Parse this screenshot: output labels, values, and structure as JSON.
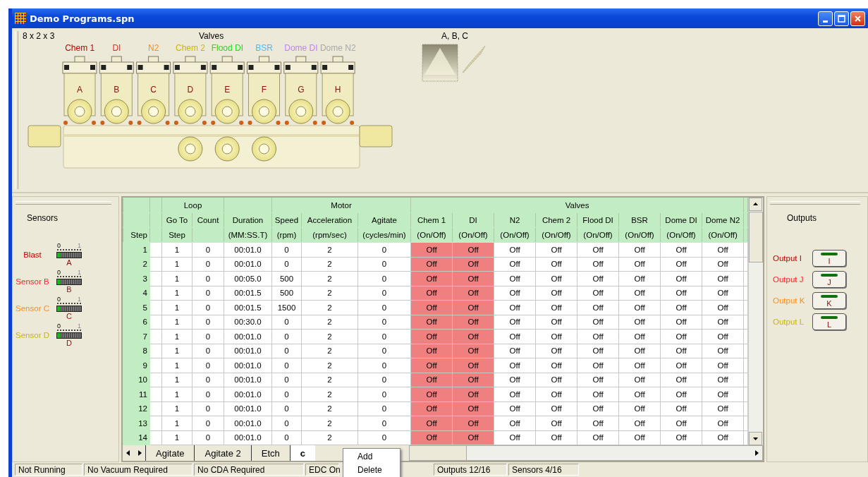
{
  "window": {
    "title": "Demo Programs.spn"
  },
  "manifold": {
    "config": "8 x 2 x 3",
    "title": "Valves",
    "valves": [
      {
        "label": "Chem 1",
        "color": "#c00000",
        "letter": "A"
      },
      {
        "label": "DI",
        "color": "#ff2020",
        "letter": "B"
      },
      {
        "label": "N2",
        "color": "#ff8c1a",
        "letter": "C"
      },
      {
        "label": "Chem 2",
        "color": "#c8b800",
        "letter": "D"
      },
      {
        "label": "Flood DI",
        "color": "#20e020",
        "letter": "E"
      },
      {
        "label": "BSR",
        "color": "#50b8ff",
        "letter": "F"
      },
      {
        "label": "Dome DI",
        "color": "#c080ff",
        "letter": "G"
      },
      {
        "label": "Dome N2",
        "color": "#a8a8a8",
        "letter": "H"
      }
    ],
    "nozzle_title": "A, B, C"
  },
  "sensors": {
    "title": "Sensors",
    "items": [
      {
        "name": "Blast",
        "color": "#c00000",
        "letter": "A",
        "scale_min": "0",
        "scale_max": "1",
        "level": 0.12
      },
      {
        "name": "Sensor B",
        "color": "#ff2020",
        "letter": "B",
        "scale_min": "0",
        "scale_max": "1",
        "level": 0.12
      },
      {
        "name": "Sensor C",
        "color": "#ff8c1a",
        "letter": "C",
        "scale_min": "0",
        "scale_max": "1",
        "level": 0.12
      },
      {
        "name": "Sensor D",
        "color": "#c8b800",
        "letter": "D",
        "scale_min": "0",
        "scale_max": "1",
        "level": 0.12
      }
    ]
  },
  "table": {
    "step_header": "Step",
    "loop": {
      "title": "Loop",
      "goto": [
        "Go To",
        "Step"
      ],
      "count": "Count"
    },
    "duration": [
      "Duration",
      "(MM:SS.T)"
    ],
    "motor": {
      "title": "Motor",
      "columns": [
        [
          "Speed",
          "(rpm)"
        ],
        [
          "Acceleration",
          "(rpm/sec)"
        ],
        [
          "Agitate",
          "(cycles/min)"
        ]
      ]
    },
    "valves_title": "Valves",
    "valve_columns": [
      {
        "name": "Chem 1",
        "unit": "(On/Off)",
        "highlighted": true
      },
      {
        "name": "DI",
        "unit": "(On/Off)",
        "highlighted": true
      },
      {
        "name": "N2",
        "unit": "(On/Off)",
        "highlighted": false
      },
      {
        "name": "Chem 2",
        "unit": "(On/Off)",
        "highlighted": false
      },
      {
        "name": "Flood DI",
        "unit": "(On/Off)",
        "highlighted": false
      },
      {
        "name": "BSR",
        "unit": "(On/Off)",
        "highlighted": false
      },
      {
        "name": "Dome DI",
        "unit": "(On/Off)",
        "highlighted": false
      },
      {
        "name": "Dome N2",
        "unit": "(On/Off)",
        "highlighted": false
      }
    ],
    "rows": [
      {
        "step": "1",
        "goto": "1",
        "count": "0",
        "duration": "00:01.0",
        "motor": [
          "0",
          "2",
          "0"
        ],
        "valves": [
          "Off",
          "Off",
          "Off",
          "Off",
          "Off",
          "Off",
          "Off",
          "Off"
        ]
      },
      {
        "step": "2",
        "goto": "1",
        "count": "0",
        "duration": "00:01.0",
        "motor": [
          "0",
          "2",
          "0"
        ],
        "valves": [
          "Off",
          "Off",
          "Off",
          "Off",
          "Off",
          "Off",
          "Off",
          "Off"
        ]
      },
      {
        "step": "3",
        "goto": "1",
        "count": "0",
        "duration": "00:05.0",
        "motor": [
          "500",
          "2",
          "0"
        ],
        "valves": [
          "Off",
          "Off",
          "Off",
          "Off",
          "Off",
          "Off",
          "Off",
          "Off"
        ]
      },
      {
        "step": "4",
        "goto": "1",
        "count": "0",
        "duration": "00:01.5",
        "motor": [
          "500",
          "2",
          "0"
        ],
        "valves": [
          "Off",
          "Off",
          "Off",
          "Off",
          "Off",
          "Off",
          "Off",
          "Off"
        ]
      },
      {
        "step": "5",
        "goto": "1",
        "count": "0",
        "duration": "00:01.5",
        "motor": [
          "1500",
          "2",
          "0"
        ],
        "valves": [
          "Off",
          "Off",
          "Off",
          "Off",
          "Off",
          "Off",
          "Off",
          "Off"
        ]
      },
      {
        "step": "6",
        "goto": "1",
        "count": "0",
        "duration": "00:30.0",
        "motor": [
          "0",
          "2",
          "0"
        ],
        "valves": [
          "Off",
          "Off",
          "Off",
          "Off",
          "Off",
          "Off",
          "Off",
          "Off"
        ]
      },
      {
        "step": "7",
        "goto": "1",
        "count": "0",
        "duration": "00:01.0",
        "motor": [
          "0",
          "2",
          "0"
        ],
        "valves": [
          "Off",
          "Off",
          "Off",
          "Off",
          "Off",
          "Off",
          "Off",
          "Off"
        ]
      },
      {
        "step": "8",
        "goto": "1",
        "count": "0",
        "duration": "00:01.0",
        "motor": [
          "0",
          "2",
          "0"
        ],
        "valves": [
          "Off",
          "Off",
          "Off",
          "Off",
          "Off",
          "Off",
          "Off",
          "Off"
        ]
      },
      {
        "step": "9",
        "goto": "1",
        "count": "0",
        "duration": "00:01.0",
        "motor": [
          "0",
          "2",
          "0"
        ],
        "valves": [
          "Off",
          "Off",
          "Off",
          "Off",
          "Off",
          "Off",
          "Off",
          "Off"
        ]
      },
      {
        "step": "10",
        "goto": "1",
        "count": "0",
        "duration": "00:01.0",
        "motor": [
          "0",
          "2",
          "0"
        ],
        "valves": [
          "Off",
          "Off",
          "Off",
          "Off",
          "Off",
          "Off",
          "Off",
          "Off"
        ]
      },
      {
        "step": "11",
        "goto": "1",
        "count": "0",
        "duration": "00:01.0",
        "motor": [
          "0",
          "2",
          "0"
        ],
        "valves": [
          "Off",
          "Off",
          "Off",
          "Off",
          "Off",
          "Off",
          "Off",
          "Off"
        ]
      },
      {
        "step": "12",
        "goto": "1",
        "count": "0",
        "duration": "00:01.0",
        "motor": [
          "0",
          "2",
          "0"
        ],
        "valves": [
          "Off",
          "Off",
          "Off",
          "Off",
          "Off",
          "Off",
          "Off",
          "Off"
        ]
      },
      {
        "step": "13",
        "goto": "1",
        "count": "0",
        "duration": "00:01.0",
        "motor": [
          "0",
          "2",
          "0"
        ],
        "valves": [
          "Off",
          "Off",
          "Off",
          "Off",
          "Off",
          "Off",
          "Off",
          "Off"
        ]
      },
      {
        "step": "14",
        "goto": "1",
        "count": "0",
        "duration": "00:01.0",
        "motor": [
          "0",
          "2",
          "0"
        ],
        "valves": [
          "Off",
          "Off",
          "Off",
          "Off",
          "Off",
          "Off",
          "Off",
          "Off"
        ]
      }
    ]
  },
  "tabs": [
    {
      "label": "Agitate",
      "selected": false
    },
    {
      "label": "Agitate 2",
      "selected": false
    },
    {
      "label": "Etch",
      "selected": false
    },
    {
      "label": "c",
      "selected": true
    }
  ],
  "context_menu": {
    "items": [
      "Add",
      "Delete"
    ]
  },
  "outputs": {
    "title": "Outputs",
    "items": [
      {
        "name": "Output I",
        "color": "#c00000",
        "letter": "I"
      },
      {
        "name": "Output J",
        "color": "#ff2020",
        "letter": "J"
      },
      {
        "name": "Output K",
        "color": "#ff8c1a",
        "letter": "K"
      },
      {
        "name": "Output L",
        "color": "#c8b800",
        "letter": "L"
      }
    ]
  },
  "status_bar": [
    {
      "text": "Not Running",
      "kind": "left"
    },
    {
      "text": "No Vacuum Required",
      "kind": "left"
    },
    {
      "text": "No CDA Required",
      "kind": "left"
    },
    {
      "text": "EDC On",
      "kind": "left"
    },
    {
      "text": "Outputs 12/16",
      "kind": "right"
    },
    {
      "text": "Sensors 4/16",
      "kind": "right"
    }
  ]
}
